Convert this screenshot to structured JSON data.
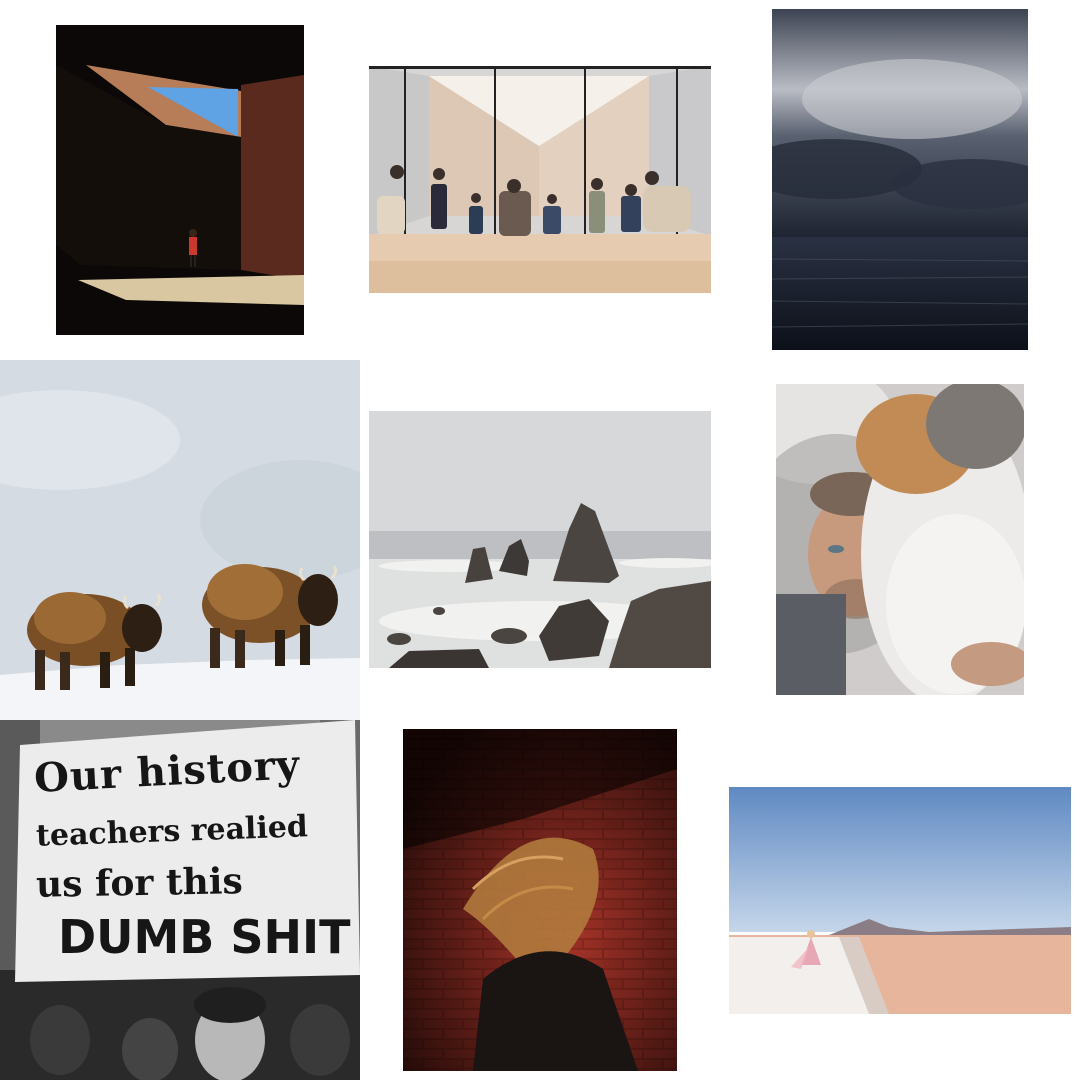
{
  "protest_sign": {
    "line1": "Our history",
    "line2": "teachers realied",
    "line3": "us for this",
    "line4": "DUMB SHIT"
  }
}
